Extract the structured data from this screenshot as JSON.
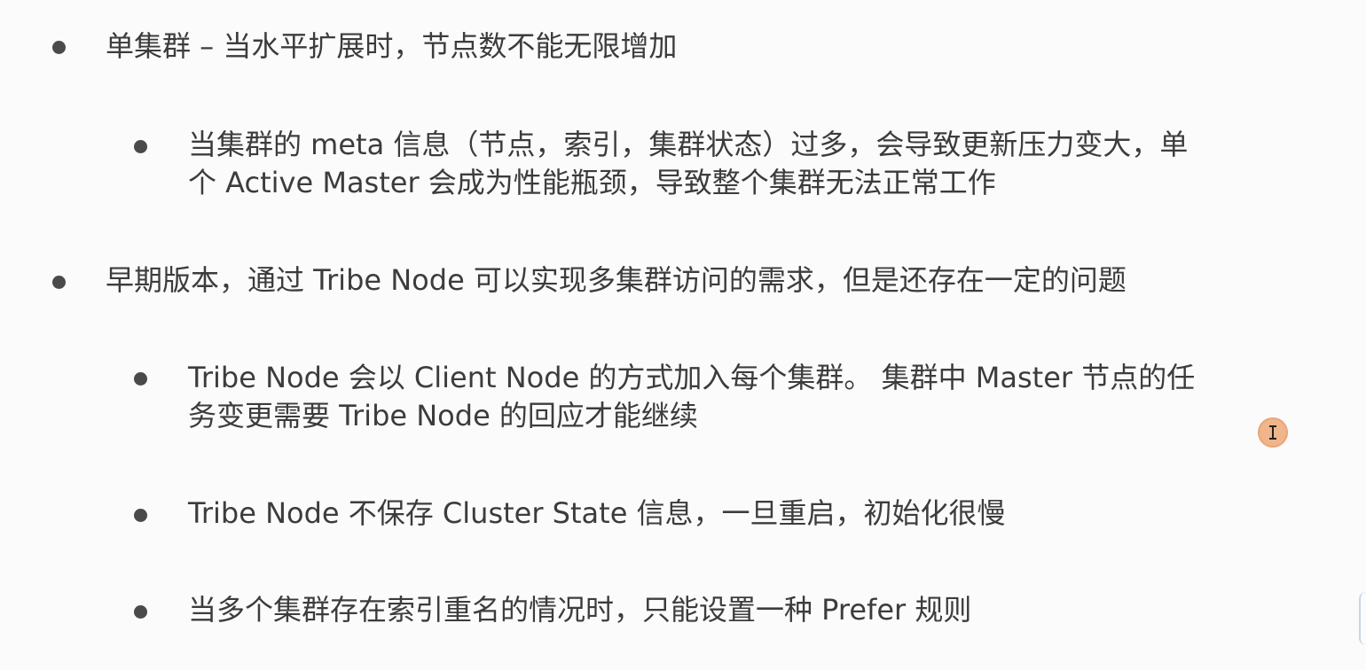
{
  "slide": {
    "items": [
      {
        "level": 1,
        "text": "单集群 – 当水平扩展时，节点数不能无限增加"
      },
      {
        "level": 2,
        "lines": [
          "当集群的 meta 信息（节点，索引，集群状态）过多，会导致更新压力变大，单",
          "个 Active Master 会成为性能瓶颈，导致整个集群无法正常工作"
        ]
      },
      {
        "level": 1,
        "text": "早期版本，通过 Tribe Node 可以实现多集群访问的需求，但是还存在一定的问题"
      },
      {
        "level": 2,
        "lines": [
          "Tribe Node 会以 Client Node 的方式加入每个集群。 集群中 Master 节点的任",
          "务变更需要 Tribe Node 的回应才能继续"
        ]
      },
      {
        "level": 2,
        "text": "Tribe Node 不保存 Cluster State 信息，一旦重启，初始化很慢"
      },
      {
        "level": 2,
        "text": "当多个集群存在索引重名的情况时，只能设置一种 Prefer 规则"
      }
    ]
  },
  "cursor": {
    "icon": "text-cursor-icon",
    "highlight_color": "#f0b58a"
  }
}
